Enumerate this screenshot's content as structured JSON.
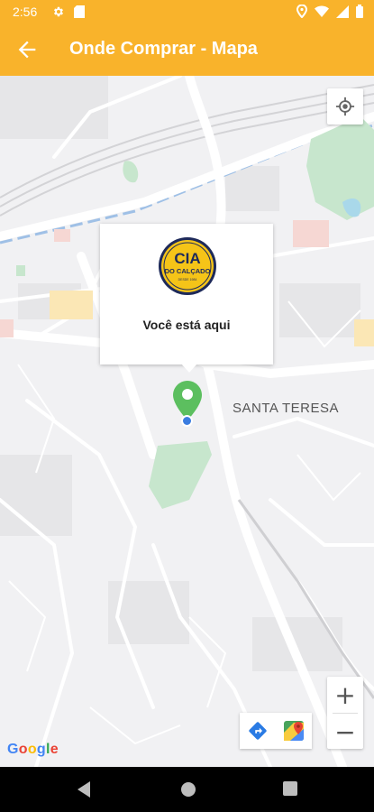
{
  "status_bar": {
    "time": "2:56",
    "icons": [
      "gear-icon",
      "sd-card-icon",
      "location-icon",
      "wifi-icon",
      "signal-icon",
      "battery-icon"
    ]
  },
  "app_bar": {
    "title": "Onde Comprar - Mapa",
    "back_icon": "arrow-back-icon",
    "color": "#f9b32b"
  },
  "map": {
    "info_window": {
      "logo_text_main": "CIA",
      "logo_text_sub": "DO CALÇADO",
      "logo_text_small": "DESDE 1984",
      "message": "Você está aqui"
    },
    "district_label": "SANTA TERESA",
    "attribution": "Google",
    "controls": {
      "zoom_in": "+",
      "zoom_out": "−",
      "my_location_icon": "my-location-icon",
      "directions_icon": "directions-icon",
      "google-maps-icon": "google-maps-icon"
    },
    "marker_color": "#5cbf5f",
    "user_dot_color": "#3b7de0"
  },
  "nav_bar": {
    "icons": [
      "back-triangle-icon",
      "home-circle-icon",
      "recents-square-icon"
    ]
  }
}
